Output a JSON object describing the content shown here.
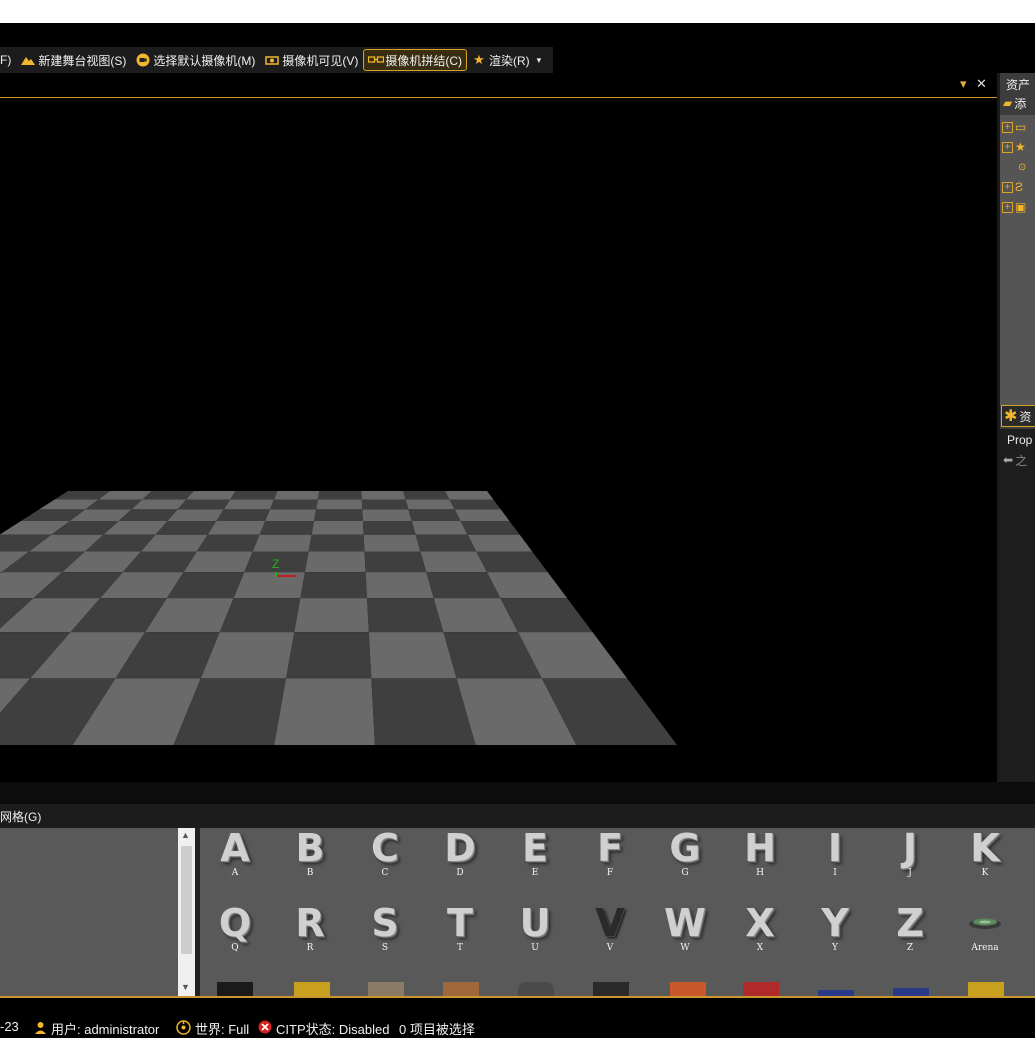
{
  "toolbar": {
    "partial_left": "F)",
    "buttons": [
      {
        "label": "新建舞台视图(S)",
        "icon": "mountain-icon"
      },
      {
        "label": "选择默认摄像机(M)",
        "icon": "camera-circle-icon"
      },
      {
        "label": "摄像机可见(V)",
        "icon": "camera-icon"
      },
      {
        "label": "摄像机拼结(C)",
        "icon": "camera-link-icon"
      },
      {
        "label": "渲染(R)",
        "icon": "star-icon"
      }
    ],
    "dropdown_caret": "▾"
  },
  "viewport": {
    "menu_caret": "▾",
    "close": "✕",
    "axis_label": "Z"
  },
  "right_panel": {
    "title": "资产",
    "add_label": "添",
    "assets_tab_label": "资",
    "props_label": "Prop",
    "back_label": "之"
  },
  "grid": {
    "header_label": "网格(G)",
    "letters_row1": [
      "A",
      "B",
      "C",
      "D",
      "E",
      "F",
      "G",
      "H",
      "I",
      "J",
      "K"
    ],
    "letters_row2": [
      "Q",
      "R",
      "S",
      "T",
      "U",
      "V",
      "W",
      "X",
      "Y",
      "Z"
    ],
    "captions_row1": [
      "A",
      "B",
      "C",
      "D",
      "E",
      "F",
      "G",
      "H",
      "I",
      "J",
      "K"
    ],
    "captions_row2": [
      "Q",
      "R",
      "S",
      "T",
      "U",
      "V",
      "W",
      "X",
      "Y",
      "Z"
    ],
    "arena_label": "Arena"
  },
  "status": {
    "date_fragment": "-23",
    "user": "用户: administrator",
    "world": "世界: Full",
    "citp": "CITP状态: Disabled",
    "selection": "0 项目被选择"
  },
  "colors": {
    "accent": "#d9a32a",
    "checker_light": "#6a6a6a",
    "checker_dark": "#3f3f3f"
  }
}
